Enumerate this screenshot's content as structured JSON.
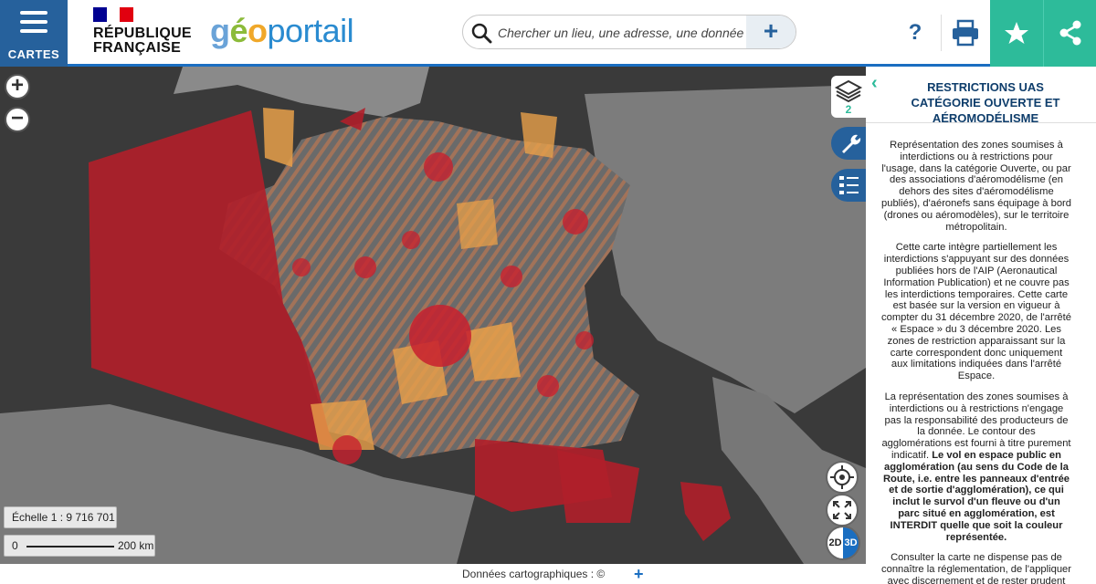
{
  "header": {
    "menu_label": "CARTES",
    "rf_line1": "RÉPUBLIQUE",
    "rf_line2": "FRANÇAISE",
    "logo_part1": "g",
    "logo_part2": "é",
    "logo_part3": "o",
    "logo_part4": "portail",
    "search_placeholder": "Chercher un lieu, une adresse, une donnée",
    "search_add": "+",
    "help": "?"
  },
  "tools": {
    "layers_count": "2",
    "zoom_in": "+",
    "zoom_out": "−",
    "mode_2d": "2D",
    "mode_3d": "3D"
  },
  "scale": {
    "label": "Échelle 1 : 9 716 701",
    "zero": "0",
    "distance": "200 km"
  },
  "footer": {
    "credits": "Données cartographiques : ©",
    "more": "+"
  },
  "panel": {
    "title": "RESTRICTIONS UAS CATÉGORIE OUVERTE ET AÉROMODÉLISME",
    "p1": "Représentation des zones soumises à interdictions ou à restrictions pour l'usage, dans la catégorie Ouverte, ou par des associations d'aéromodélisme (en dehors des sites d'aéromodélisme publiés), d'aéronefs sans équipage à bord (drones ou aéromodèles), sur le territoire métropolitain.",
    "p2": "Cette carte intègre partiellement les interdictions s'appuyant sur des données publiées hors de l'AIP (Aeronautical Information Publication) et ne couvre pas les interdictions temporaires. Cette carte est basée sur la version en vigueur à compter du 31 décembre 2020, de l'arrêté « Espace » du 3 décembre 2020. Les zones de restriction apparaissant sur la carte correspondent donc uniquement aux limitations indiquées dans l'arrêté Espace.",
    "p3_normal": "La représentation des zones soumises à interdictions ou à restrictions n'engage pas la responsabilité des producteurs de la donnée. Le contour des agglomérations est fourni à titre purement indicatif.",
    "p3_bold": "Le vol en espace public en agglomération (au sens du Code de la Route, i.e. entre les panneaux d'entrée et de sortie d'agglomération), ce qui inclut le survol d'un fleuve ou d'un parc situé en agglomération, est INTERDIT quelle que soit la couleur représentée.",
    "p4": "Consulter la carte ne dispense pas de connaître la réglementation, de l'appliquer avec discernement et de rester prudent"
  },
  "colors": {
    "brand_blue": "#26619c",
    "accent_teal": "#2dbb9a",
    "zone_red": "#c8202e",
    "zone_orange": "#e8a04a",
    "panel_title": "#0e3d6b"
  }
}
